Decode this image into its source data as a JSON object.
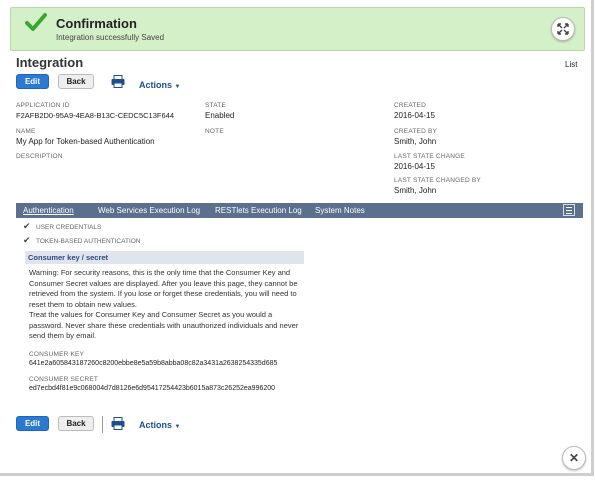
{
  "banner": {
    "title": "Confirmation",
    "message": "Integration successfully Saved"
  },
  "page": {
    "title": "Integration",
    "list_link": "List"
  },
  "toolbar": {
    "edit_label": "Edit",
    "back_label": "Back",
    "actions_label": "Actions"
  },
  "fields": {
    "application_id": {
      "label": "APPLICATION ID",
      "value": "F2AFB2D0-95A9-4EA8-B13C-CEDC5C13F644"
    },
    "name": {
      "label": "NAME",
      "value": "My App for Token-based Authentication"
    },
    "description": {
      "label": "DESCRIPTION",
      "value": ""
    },
    "state": {
      "label": "STATE",
      "value": "Enabled"
    },
    "note": {
      "label": "NOTE",
      "value": ""
    },
    "created": {
      "label": "CREATED",
      "value": "2016-04-15"
    },
    "created_by": {
      "label": "CREATED BY",
      "value": "Smith, John"
    },
    "last_state_change": {
      "label": "LAST STATE CHANGE",
      "value": "2016-04-15"
    },
    "last_state_changed_by": {
      "label": "LAST STATE CHANGED BY",
      "value": "Smith, John"
    }
  },
  "tabs": [
    {
      "label": "Authentication"
    },
    {
      "label": "Web Services Execution Log"
    },
    {
      "label": "RESTlets Execution Log"
    },
    {
      "label": "System Notes"
    }
  ],
  "auth": {
    "user_credentials": "USER CREDENTIALS",
    "token_based": "TOKEN-BASED AUTHENTICATION",
    "panel_title": "Consumer key / secret",
    "warning_1": "Warning: For security reasons, this is the only time that the Consumer Key and Consumer Secret values are displayed. After you leave this page, they cannot be retrieved from the system. If you lose or forget these credentials, you will need to reset them to obtain new values.",
    "warning_2": "Treat the values for Consumer Key and Consumer Secret as you would a password. Never share these credentials with unauthorized individuals and never send them by email.",
    "consumer_key_label": "CONSUMER KEY",
    "consumer_key_value": "641e2a605843187260c8200ebbe8e5a59b8abba08c82a3431a2638254335d685",
    "consumer_secret_label": "CONSUMER SECRET",
    "consumer_secret_value": "ed7ecbd4f81e9c068004d7d8126e6d95417254423b6015a873c26252ea996200"
  },
  "colors": {
    "banner_bg": "#d4f0c8",
    "primary": "#2a7ad3",
    "tabbar": "#5b6f8f"
  },
  "icons": {
    "banner": "checkmark-icon",
    "expand": "expand-icon",
    "print": "printer-icon",
    "close": "close-icon",
    "tab_menu": "menu-icon"
  }
}
